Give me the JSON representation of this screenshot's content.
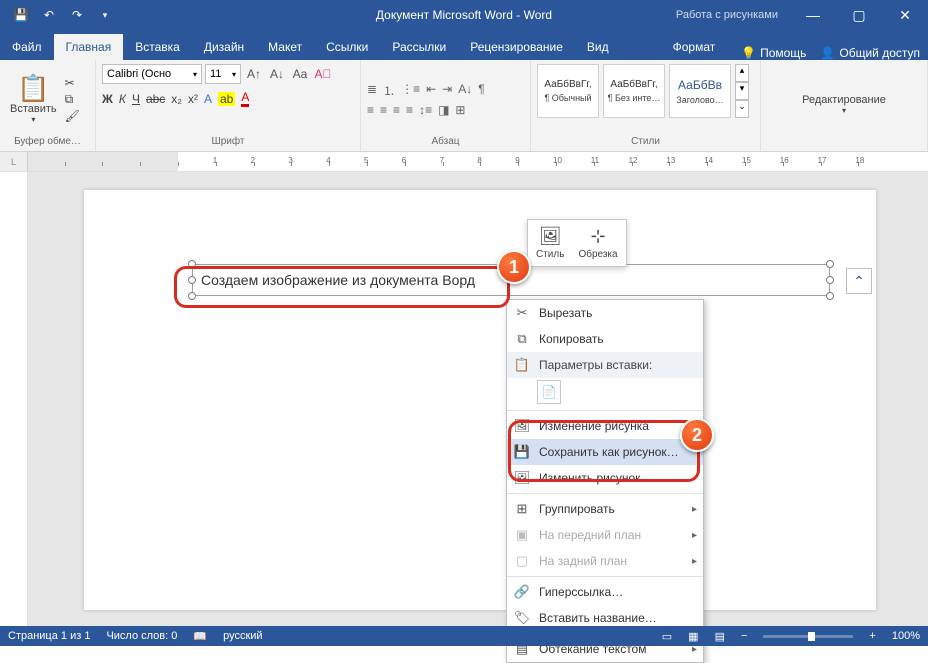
{
  "window": {
    "title": "Документ Microsoft Word - Word",
    "tools_tab": "Работа с рисунками"
  },
  "tabs": {
    "file": "Файл",
    "home": "Главная",
    "insert": "Вставка",
    "design": "Дизайн",
    "layout": "Макет",
    "references": "Ссылки",
    "mailings": "Рассылки",
    "review": "Рецензирование",
    "view": "Вид",
    "format": "Формат",
    "help": "Помощь",
    "share": "Общий доступ"
  },
  "ribbon": {
    "clipboard": {
      "paste": "Вставить",
      "label": "Буфер обме…"
    },
    "font": {
      "name": "Calibri (Осно",
      "size": "11",
      "label": "Шрифт",
      "bold": "Ж",
      "italic": "К",
      "underline": "Ч",
      "strike": "abc",
      "sub": "x₂",
      "sup": "x²"
    },
    "paragraph": {
      "label": "Абзац"
    },
    "styles": {
      "label": "Стили",
      "s1": {
        "preview": "АаБбВвГг,",
        "name": "¶ Обычный"
      },
      "s2": {
        "preview": "АаБбВвГг,",
        "name": "¶ Без инте…"
      },
      "s3": {
        "preview": "АаБбВв",
        "name": "Заголово…"
      }
    },
    "editing": {
      "label": "Редактирование"
    }
  },
  "document": {
    "text_content": "Создаем изображение из документа Ворд"
  },
  "mini_toolbar": {
    "style": "Стиль",
    "crop": "Обрезка"
  },
  "context_menu": {
    "cut": "Вырезать",
    "copy": "Копировать",
    "paste_options": "Параметры вставки:",
    "edit_picture": "Изменение рисунка",
    "save_as_picture": "Сохранить как рисунок…",
    "change_picture": "Изменить рисунок…",
    "group": "Группировать",
    "bring_front": "На передний план",
    "send_back": "На задний план",
    "hyperlink": "Гиперссылка…",
    "insert_caption": "Вставить название…",
    "text_wrapping": "Обтекание текстом"
  },
  "callouts": {
    "one": "1",
    "two": "2"
  },
  "statusbar": {
    "page": "Страница 1 из 1",
    "words": "Число слов: 0",
    "lang": "русский",
    "zoom": "100%"
  }
}
